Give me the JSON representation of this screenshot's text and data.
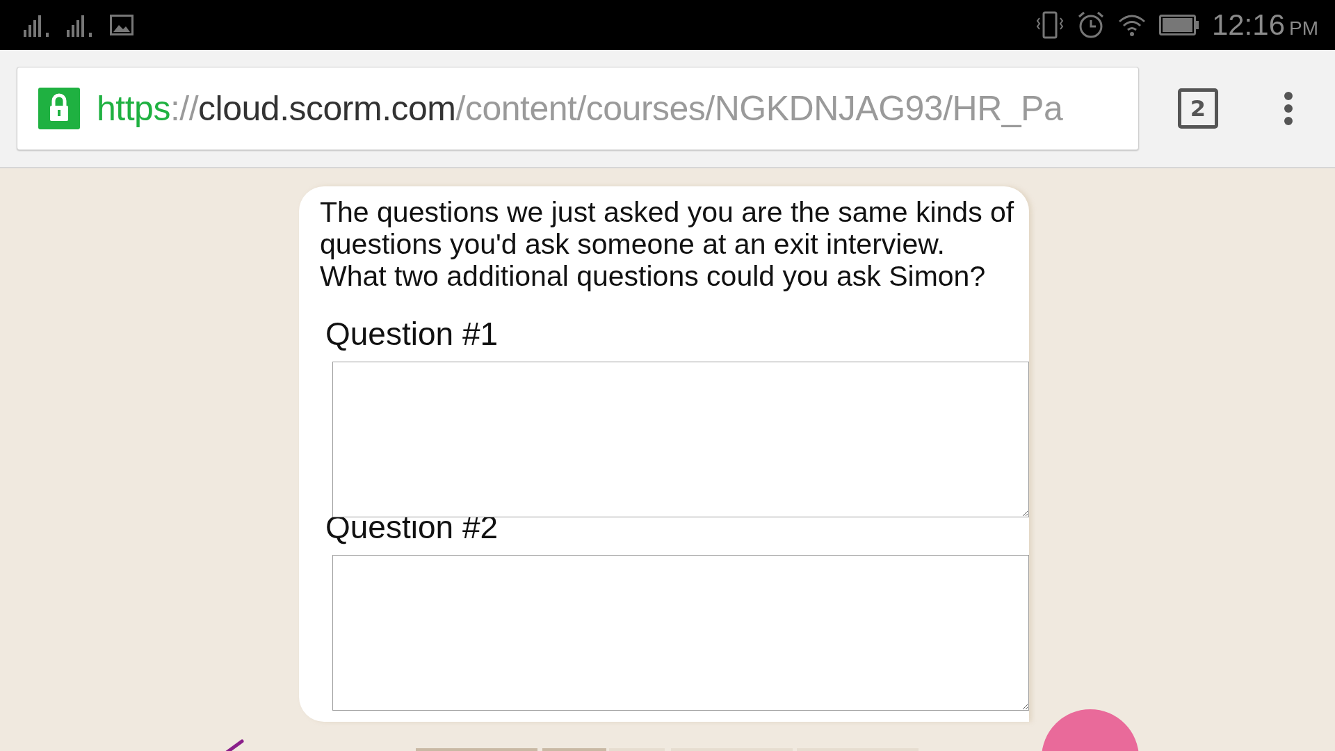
{
  "status_bar": {
    "time": "12:16",
    "meridiem": "PM"
  },
  "browser": {
    "url": [
      {
        "text": "https",
        "kind": "scheme"
      },
      {
        "text": "://",
        "kind": "separator"
      },
      {
        "text": "cloud.scorm.com",
        "kind": "host"
      },
      {
        "text": "/content/courses/NGKDNJAG93/HR_Pa",
        "kind": "path"
      }
    ],
    "tab_count": "2"
  },
  "card": {
    "prompt": "The questions we just asked you are the same kinds of questions you'd ask someone at an exit interview. What two additional questions could you ask Simon?",
    "questions": [
      {
        "label": "Question #1"
      },
      {
        "label": "Question #2"
      }
    ]
  }
}
